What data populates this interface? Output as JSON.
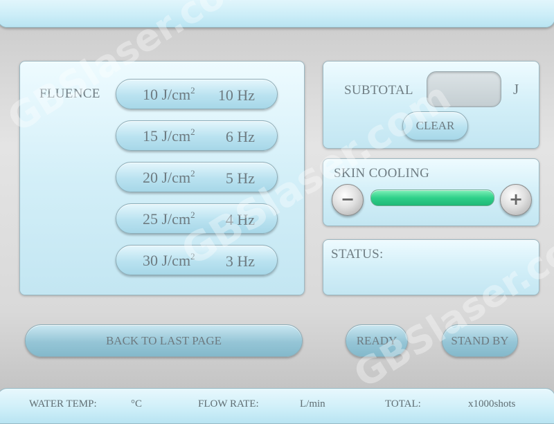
{
  "fluence": {
    "label": "FLUENCE",
    "options": [
      {
        "energy": "10 J/cm",
        "sup": "2",
        "freq": "10 Hz"
      },
      {
        "energy": "15 J/cm",
        "sup": "2",
        "freq": "6 Hz"
      },
      {
        "energy": "20 J/cm",
        "sup": "2",
        "freq": "5 Hz"
      },
      {
        "energy": "25 J/cm",
        "sup": "2",
        "freq": "4 Hz"
      },
      {
        "energy": "30 J/cm",
        "sup": "2",
        "freq": "3 Hz"
      }
    ]
  },
  "subtotal": {
    "label": "SUBTOTAL",
    "value": "",
    "unit": "J",
    "clear_label": "CLEAR"
  },
  "skin_cooling": {
    "label": "SKIN COOLING",
    "minus_symbol": "−",
    "plus_symbol": "+",
    "level_fraction": 1.0,
    "bar_color": "#2fd08a"
  },
  "status": {
    "label": "STATUS:",
    "value": ""
  },
  "actions": {
    "back_label": "BACK TO LAST PAGE",
    "ready_label": "READY",
    "standby_label": "STAND BY"
  },
  "footer": {
    "water_temp_label": "WATER TEMP:",
    "water_temp_unit": "°C",
    "flow_rate_label": "FLOW RATE:",
    "flow_rate_unit": "L/min",
    "total_label": "TOTAL:",
    "total_unit": "x1000shots"
  },
  "watermark": {
    "text": "GBSlaser.com"
  }
}
